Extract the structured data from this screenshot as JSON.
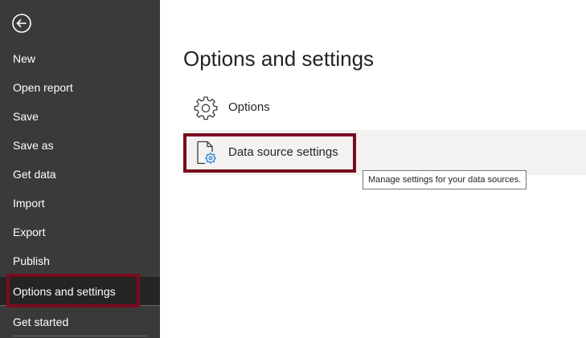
{
  "sidebar": {
    "back_icon": "back-arrow-circle-icon",
    "items": [
      {
        "label": "New"
      },
      {
        "label": "Open report"
      },
      {
        "label": "Save"
      },
      {
        "label": "Save as"
      },
      {
        "label": "Get data"
      },
      {
        "label": "Import"
      },
      {
        "label": "Export"
      },
      {
        "label": "Publish"
      },
      {
        "label": "Options and settings",
        "selected": true
      },
      {
        "label": "Get started"
      }
    ]
  },
  "main": {
    "title": "Options and settings",
    "options": [
      {
        "label": "Options",
        "icon": "gear-icon"
      },
      {
        "label": "Data source settings",
        "icon": "document-gear-icon",
        "hovered": true
      }
    ],
    "tooltip": "Manage settings for your data sources."
  },
  "colors": {
    "sidebar_bg": "#3b3a39",
    "sidebar_selected_bg": "#252423",
    "highlight_border": "#7a0b1e",
    "hover_bg": "#f3f2f1",
    "icon_accent": "#2b88d8"
  }
}
